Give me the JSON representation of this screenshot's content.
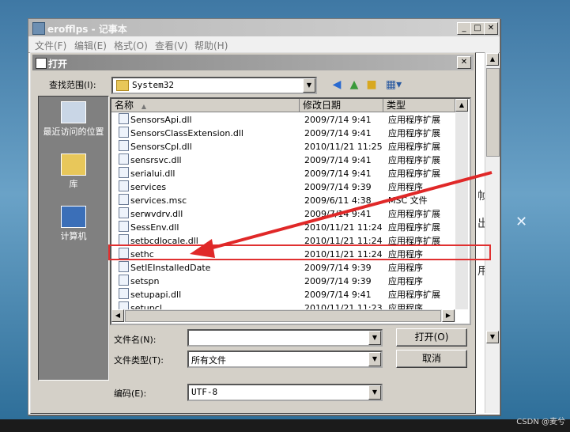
{
  "notepad": {
    "title": "erofflps - 记事本",
    "menu": [
      "文件(F)",
      "编辑(E)",
      "格式(O)",
      "查看(V)",
      "帮助(H)"
    ],
    "side_chars": [
      "帧",
      "出",
      "用"
    ]
  },
  "dialog": {
    "title": "打开",
    "lookin_label": "查找范围(I):",
    "lookin_value": "System32",
    "places": [
      "最近访问的位置",
      "库",
      "计算机"
    ],
    "columns": [
      "名称",
      "修改日期",
      "类型"
    ],
    "files": [
      {
        "name": "SensorsApi.dll",
        "date": "2009/7/14 9:41",
        "type": "应用程序扩展"
      },
      {
        "name": "SensorsClassExtension.dll",
        "date": "2009/7/14 9:41",
        "type": "应用程序扩展"
      },
      {
        "name": "SensorsCpl.dll",
        "date": "2010/11/21 11:25",
        "type": "应用程序扩展"
      },
      {
        "name": "sensrsvc.dll",
        "date": "2009/7/14 9:41",
        "type": "应用程序扩展"
      },
      {
        "name": "serialui.dll",
        "date": "2009/7/14 9:41",
        "type": "应用程序扩展"
      },
      {
        "name": "services",
        "date": "2009/7/14 9:39",
        "type": "应用程序"
      },
      {
        "name": "services.msc",
        "date": "2009/6/11 4:38",
        "type": "MSC 文件"
      },
      {
        "name": "serwvdrv.dll",
        "date": "2009/7/14 9:41",
        "type": "应用程序扩展"
      },
      {
        "name": "SessEnv.dll",
        "date": "2010/11/21 11:24",
        "type": "应用程序扩展"
      },
      {
        "name": "setbcdlocale.dll",
        "date": "2010/11/21 11:24",
        "type": "应用程序扩展"
      },
      {
        "name": "sethc",
        "date": "2010/11/21 11:24",
        "type": "应用程序"
      },
      {
        "name": "SetIEInstalledDate",
        "date": "2009/7/14 9:39",
        "type": "应用程序"
      },
      {
        "name": "setspn",
        "date": "2009/7/14 9:39",
        "type": "应用程序"
      },
      {
        "name": "setupapi.dll",
        "date": "2009/7/14 9:41",
        "type": "应用程序扩展"
      },
      {
        "name": "setupcl",
        "date": "2010/11/21 11:23",
        "type": "应用程序"
      }
    ],
    "filename_label": "文件名(N):",
    "filename_value": "",
    "filetype_label": "文件类型(T):",
    "filetype_value": "所有文件",
    "encoding_label": "编码(E):",
    "encoding_value": "UTF-8",
    "open_button": "打开(O)",
    "cancel_button": "取消"
  },
  "watermark": "CSDN @麦兮"
}
